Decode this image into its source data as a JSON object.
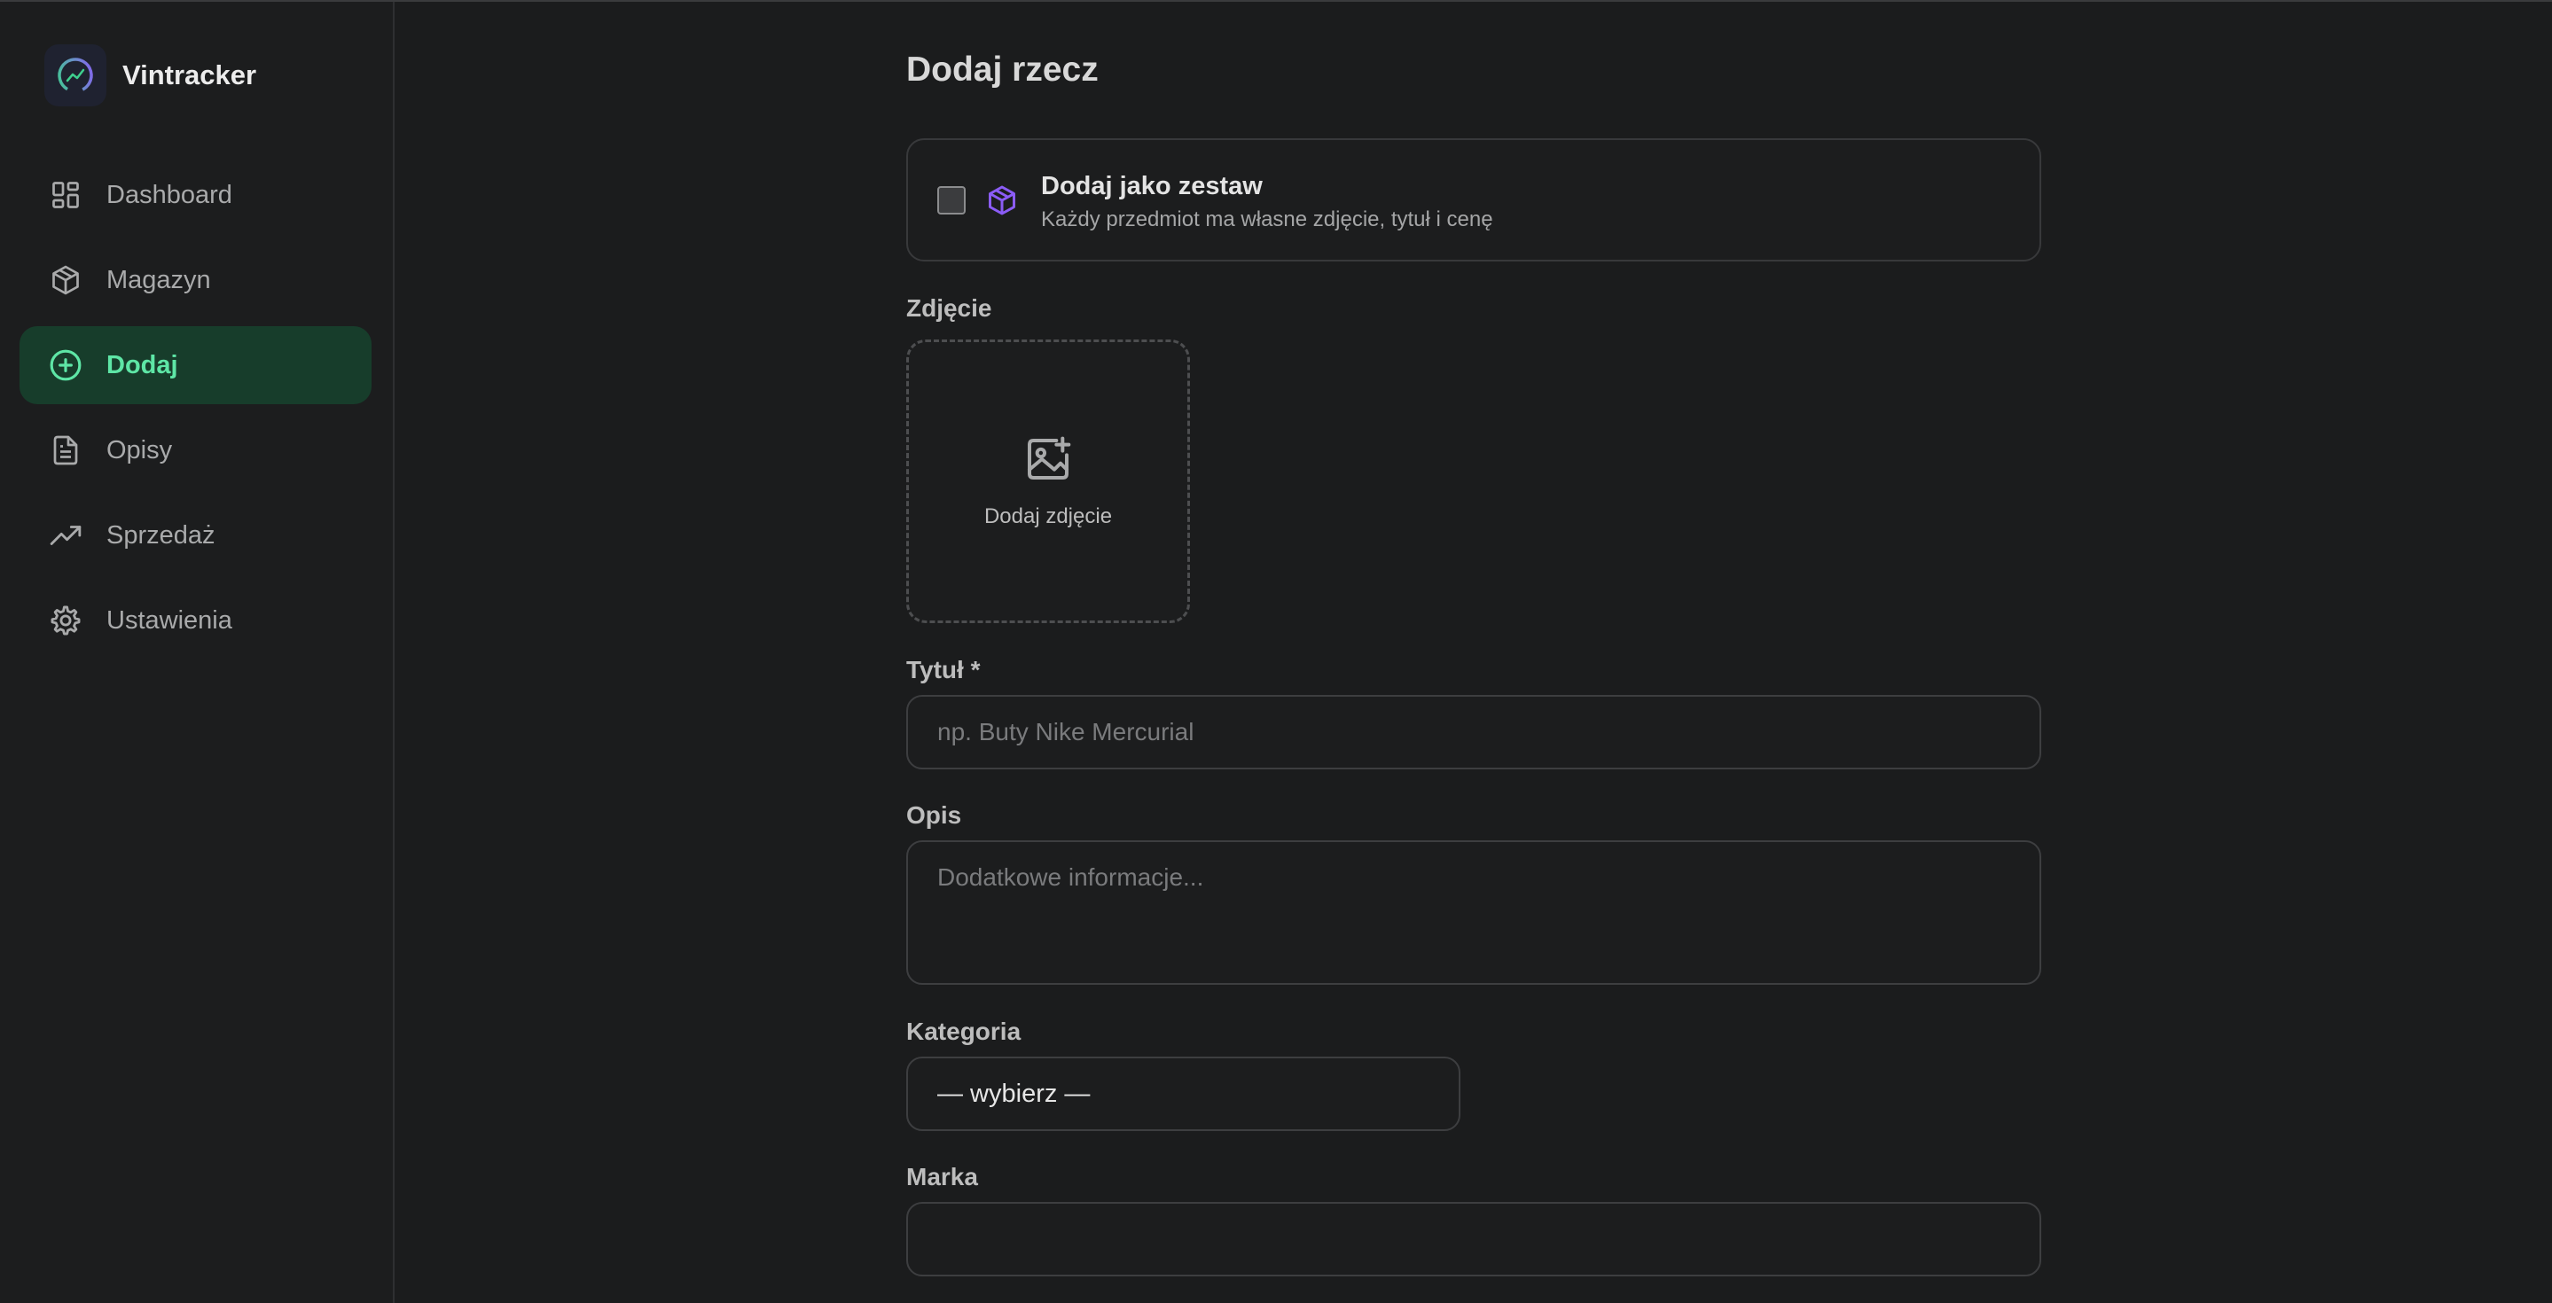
{
  "brand": {
    "name": "Vintracker"
  },
  "sidebar": {
    "items": [
      {
        "label": "Dashboard",
        "icon": "dashboard-icon",
        "active": false
      },
      {
        "label": "Magazyn",
        "icon": "package-icon",
        "active": false
      },
      {
        "label": "Dodaj",
        "icon": "plus-circle-icon",
        "active": true
      },
      {
        "label": "Opisy",
        "icon": "document-icon",
        "active": false
      },
      {
        "label": "Sprzedaż",
        "icon": "trending-up-icon",
        "active": false
      },
      {
        "label": "Ustawienia",
        "icon": "gear-icon",
        "active": false
      }
    ]
  },
  "main": {
    "title": "Dodaj rzecz",
    "set_option": {
      "title": "Dodaj jako zestaw",
      "subtitle": "Każdy przedmiot ma własne zdjęcie, tytuł i cenę",
      "checked": false
    },
    "photo": {
      "label": "Zdjęcie",
      "button": "Dodaj zdjęcie"
    },
    "title_field": {
      "label": "Tytuł *",
      "placeholder": "np. Buty Nike Mercurial",
      "value": ""
    },
    "description": {
      "label": "Opis",
      "placeholder": "Dodatkowe informacje...",
      "value": ""
    },
    "category": {
      "label": "Kategoria",
      "selected": "— wybierz —"
    },
    "brand_field": {
      "label": "Marka",
      "value": ""
    }
  },
  "colors": {
    "background": "#1b1c1d",
    "active_nav_bg": "#173d2b",
    "active_nav_text": "#5ee6a6",
    "accent_purple": "#8b5cf6"
  }
}
